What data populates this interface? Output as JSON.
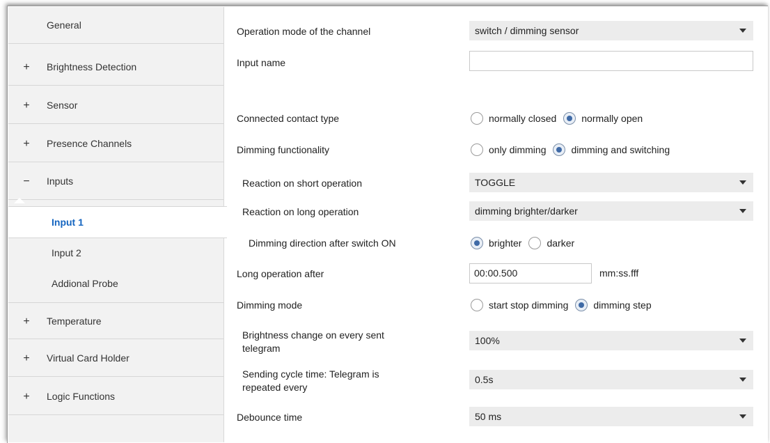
{
  "sidebar": {
    "items": [
      {
        "sign": "",
        "label": "General"
      },
      {
        "sign": "+",
        "label": "Brightness Detection"
      },
      {
        "sign": "+",
        "label": "Sensor"
      },
      {
        "sign": "+",
        "label": "Presence Channels"
      },
      {
        "sign": "−",
        "label": "Inputs"
      },
      {
        "sign": "+",
        "label": "Temperature"
      },
      {
        "sign": "+",
        "label": "Virtual Card Holder"
      },
      {
        "sign": "+",
        "label": "Logic Functions"
      }
    ],
    "subitems": [
      {
        "label": "Input 1"
      },
      {
        "label": "Input 2"
      },
      {
        "label": "Addional Probe"
      }
    ]
  },
  "main": {
    "operation_mode": {
      "label": "Operation mode of the channel",
      "value": "switch / dimming sensor"
    },
    "input_name": {
      "label": "Input name",
      "value": ""
    },
    "contact_type": {
      "label": "Connected contact type",
      "options": [
        "normally closed",
        "normally open"
      ],
      "selected": 1
    },
    "dimming_functionality": {
      "label": "Dimming functionality",
      "options": [
        "only dimming",
        "dimming and switching"
      ],
      "selected": 1
    },
    "short_operation": {
      "label": "Reaction on short operation",
      "value": "TOGGLE"
    },
    "long_operation": {
      "label": "Reaction on long operation",
      "value": "dimming brighter/darker"
    },
    "dimming_direction": {
      "label": "Dimming direction after switch ON",
      "options": [
        "brighter",
        "darker"
      ],
      "selected": 0
    },
    "long_operation_after": {
      "label": "Long operation after",
      "value": "00:00.500",
      "unit": "mm:ss.fff"
    },
    "dimming_mode": {
      "label": "Dimming mode",
      "options": [
        "start stop dimming",
        "dimming step"
      ],
      "selected": 1
    },
    "brightness_change": {
      "label_line1": "Brightness change on every sent",
      "label_line2": "telegram",
      "value": "100%"
    },
    "sending_cycle": {
      "label_line1": "Sending cycle time: Telegram is",
      "label_line2": "repeated every",
      "value": "0.5s"
    },
    "debounce": {
      "label": "Debounce time",
      "value": "50 ms"
    }
  },
  "colors": {
    "accent": "#1565c0",
    "sidebar_bg": "#f2f2f2",
    "select_bg": "#ececec"
  }
}
